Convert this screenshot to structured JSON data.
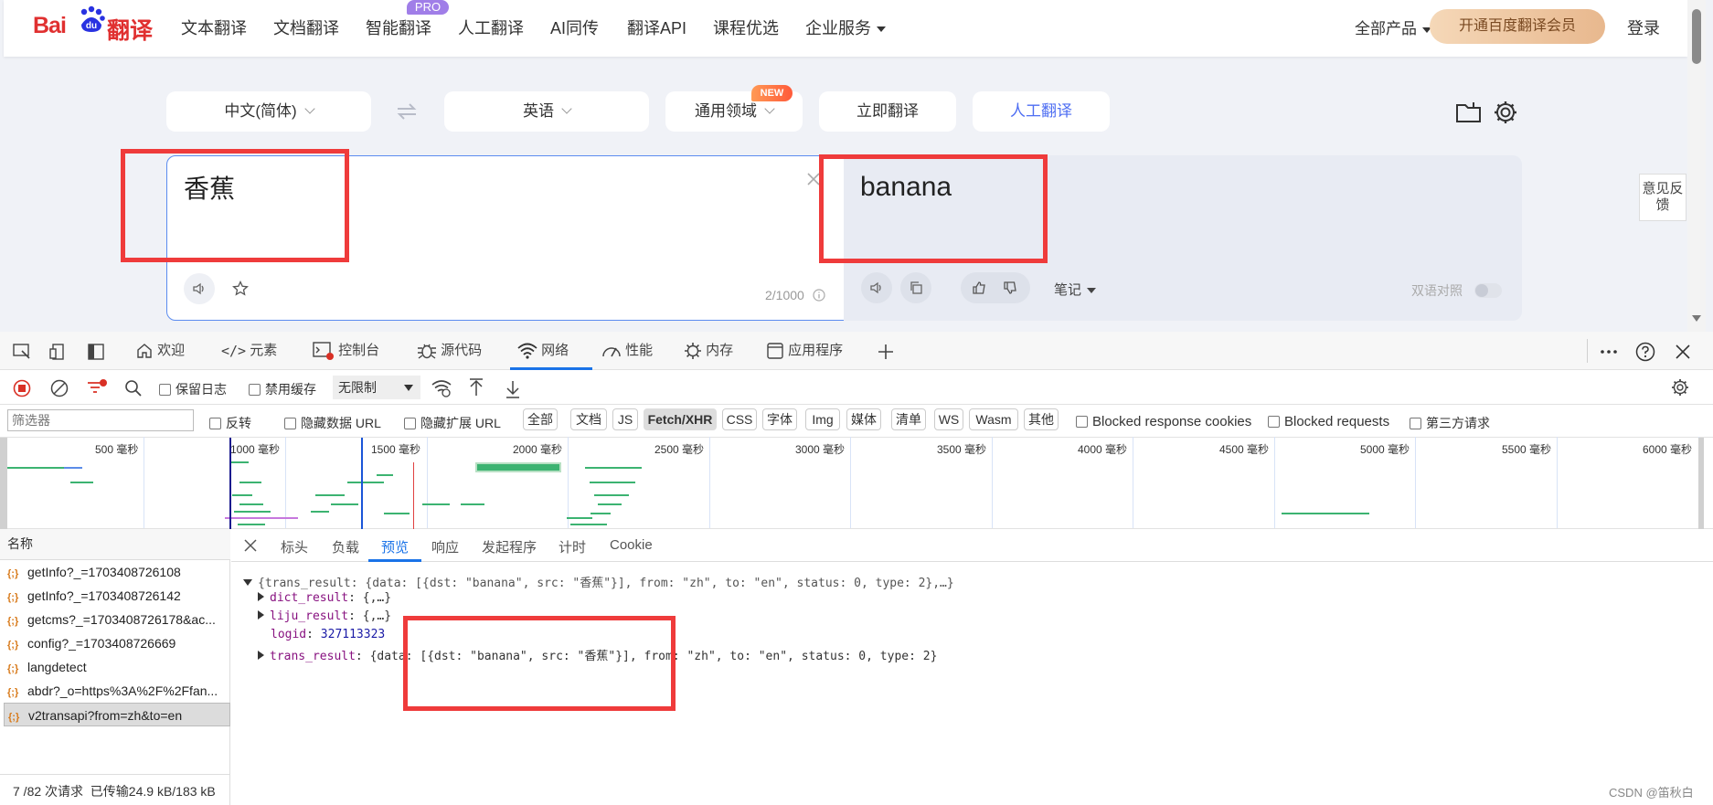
{
  "nav": {
    "logo_bai": "Bai",
    "logo_du": "du",
    "logo_fanyi": "翻译",
    "items": [
      "文本翻译",
      "文档翻译",
      "智能翻译",
      "人工翻译",
      "AI同传",
      "翻译API",
      "课程优选",
      "企业服务"
    ],
    "pro_badge": "PRO",
    "all_products": "全部产品",
    "vip_button": "开通百度翻译会员",
    "login": "登录"
  },
  "translator": {
    "source_lang": "中文(简体)",
    "target_lang": "英语",
    "domain": "通用领域",
    "new_badge": "NEW",
    "translate_now": "立即翻译",
    "human_translate": "人工翻译",
    "source_text": "香蕉",
    "char_count": "2/1000",
    "target_text": "banana",
    "notes": "笔记",
    "bilingual": "双语对照",
    "feedback": "意见反馈"
  },
  "devtools": {
    "tabs": [
      "欢迎",
      "元素",
      "控制台",
      "源代码",
      "网络",
      "性能",
      "内存",
      "应用程序"
    ],
    "active_tab": "网络",
    "toolbar": {
      "preserve_log": "保留日志",
      "disable_cache": "禁用缓存",
      "throttle": "无限制"
    },
    "filter": {
      "placeholder": "筛选器",
      "invert": "反转",
      "hide_data_url": "隐藏数据 URL",
      "hide_ext_url": "隐藏扩展 URL",
      "types": [
        "全部",
        "文档",
        "JS",
        "Fetch/XHR",
        "CSS",
        "字体",
        "Img",
        "媒体",
        "清单",
        "WS",
        "Wasm",
        "其他"
      ],
      "active_type": "Fetch/XHR",
      "blocked_cookies": "Blocked response cookies",
      "blocked_requests": "Blocked requests",
      "third_party": "第三方请求"
    },
    "timeline_ticks": [
      "500 毫秒",
      "1000 毫秒",
      "1500 毫秒",
      "2000 毫秒",
      "2500 毫秒",
      "3000 毫秒",
      "3500 毫秒",
      "4000 毫秒",
      "4500 毫秒",
      "5000 毫秒",
      "5500 毫秒",
      "6000 毫秒"
    ],
    "name_header": "名称",
    "requests": [
      "getInfo?_=1703408726108",
      "getInfo?_=1703408726142",
      "getcms?_=1703408726178&ac...",
      "config?_=1703408726669",
      "langdetect",
      "abdr?_o=https%3A%2F%2Ffan...",
      "v2transapi?from=zh&to=en"
    ],
    "selected_request": "v2transapi?from=zh&to=en",
    "status": "7 /82 次请求  已传输24.9 kB/183 kB",
    "detail_tabs": [
      "标头",
      "负载",
      "预览",
      "响应",
      "发起程序",
      "计时",
      "Cookie"
    ],
    "active_detail_tab": "预览",
    "preview": {
      "root": "{trans_result: {data: [{dst: \"banana\", src: \"香蕉\"}], from: \"zh\", to: \"en\", status: 0, type: 2},…}",
      "dict_key": "dict_result",
      "dict_val": ": {,…}",
      "liju_key": "liju_result",
      "liju_val": ": {,…}",
      "logid_key": "logid",
      "logid_val": "327113323",
      "trans_key": "trans_result",
      "trans_val": ": {data: [{dst: \"banana\", src: \"香蕉\"}], from: \"zh\", to: \"en\", status: 0, type: 2}"
    }
  },
  "watermark": "CSDN @笛秋白",
  "colors": {
    "brand_red": "#e03030",
    "highlight_red": "#ef3b3b",
    "devtools_blue": "#1a73e8"
  }
}
